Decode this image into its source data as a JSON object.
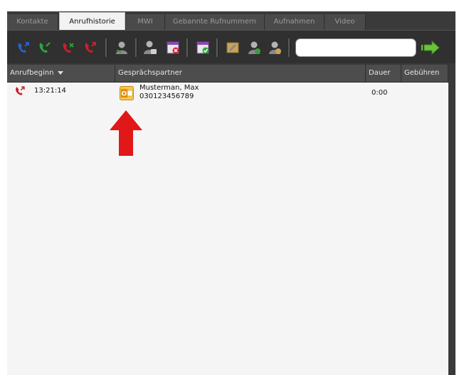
{
  "tabs": [
    {
      "label": "Kontakte",
      "active": false
    },
    {
      "label": "Anrufhistorie",
      "active": true
    },
    {
      "label": "MWI",
      "active": false
    },
    {
      "label": "Gebannte Rufnummern",
      "active": false
    },
    {
      "label": "Aufnahmen",
      "active": false
    },
    {
      "label": "Video",
      "active": false
    }
  ],
  "toolbar": {
    "icons": [
      "incoming-calls-icon",
      "answered-calls-icon",
      "missed-calls-icon",
      "outgoing-calls-icon",
      "contact-call-icon",
      "contact-block-icon",
      "delete-calendar-icon",
      "accept-calendar-icon",
      "record-edit-icon",
      "contact-group-icon",
      "contact-user-icon"
    ],
    "search": {
      "value": "",
      "placeholder": ""
    },
    "go_icon": "go-arrow-icon"
  },
  "table": {
    "columns": [
      "Anrufbeginn",
      "Gesprächspartner",
      "Dauer",
      "Gebühren"
    ],
    "sort_column": "Anrufbeginn",
    "rows": [
      {
        "call_type_icon": "missed-call-icon",
        "time": "13:21:14",
        "contact_icon": "outlook-contact-icon",
        "name": "Musterman, Max",
        "number": "030123456789",
        "duration": "0:00",
        "fees": ""
      }
    ]
  },
  "annotation": {
    "icon": "red-arrow-up-icon",
    "color": "#e01818"
  },
  "colors": {
    "background": "#3a3a3a",
    "table_bg": "#f5f5f5",
    "header_bg": "#4d4d4d",
    "missed_red": "#c8202a",
    "answered_green": "#2da63a",
    "incoming_blue": "#2a5fc9"
  }
}
